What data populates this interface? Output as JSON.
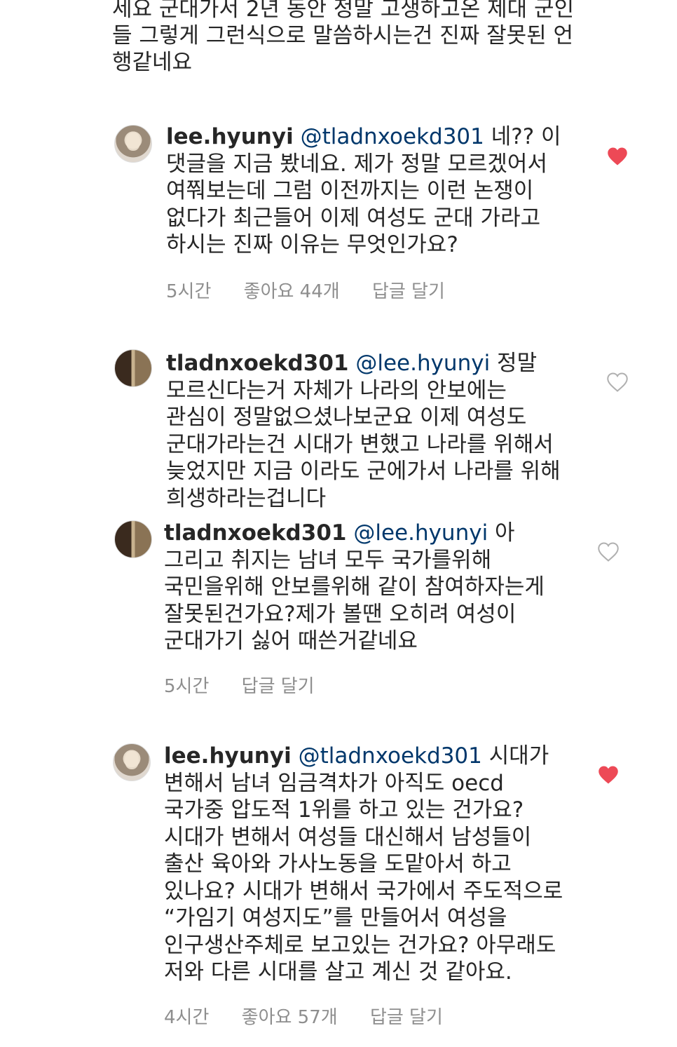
{
  "previous_comment": {
    "text": "세요 군대가서 2년 동안 정말 고생하고온 제대 군인들 그렇게 그런식으로 말씀하시는건 진짜 잘못된 언행같네요"
  },
  "comments": [
    {
      "username": "lee.hyunyi",
      "mention": "@tladnxoekd301",
      "text": "네?? 이 댓글을 지금 봤네요. 제가 정말 모르겠어서 여쭤보는데 그럼 이전까지는 이런 논쟁이 없다가 최근들어 이제 여성도 군대 가라고 하시는 진짜 이유는 무엇인가요?",
      "time": "5시간",
      "likes": "좋아요 44개",
      "reply": "답글 달기",
      "liked": true
    },
    {
      "username": "tladnxoekd301",
      "mention": "@lee.hyunyi",
      "text": "정말 모르신다는거 자체가 나라의 안보에는 관심이 정말없으셨나보군요 이제 여성도 군대가라는건 시대가 변했고 나라를 위해서 늦었지만 지금 이라도 군에가서 나라를 위해 희생하라는겁니다",
      "liked": false
    },
    {
      "username": "tladnxoekd301",
      "mention": "@lee.hyunyi",
      "text": "아 그리고 취지는 남녀 모두 국가를위해 국민을위해 안보를위해 같이 참여하자는게 잘못된건가요?제가 볼땐 오히려 여성이 군대가기 싫어 때쓴거같네요",
      "time": "5시간",
      "reply": "답글 달기",
      "liked": false
    },
    {
      "username": "lee.hyunyi",
      "mention": "@tladnxoekd301",
      "text": "시대가 변해서 남녀 임금격차가 아직도 oecd 국가중 압도적 1위를 하고 있는 건가요? 시대가 변해서 여성들 대신해서 남성들이 출산 육아와 가사노동을 도맡아서 하고 있나요? 시대가 변해서 국가에서 주도적으로 “가임기 여성지도”를 만들어서 여성을 인구생산주체로 보고있는 건가요? 아무래도 저와 다른 시대를 살고 계신 것 같아요.",
      "time": "4시간",
      "likes": "좋아요 57개",
      "reply": "답글 달기",
      "liked": true
    }
  ],
  "colors": {
    "text": "#262626",
    "mention": "#00376b",
    "meta": "#8e8e8e",
    "heart_liked": "#ed4956",
    "heart_outline": "#c7c7c7"
  }
}
